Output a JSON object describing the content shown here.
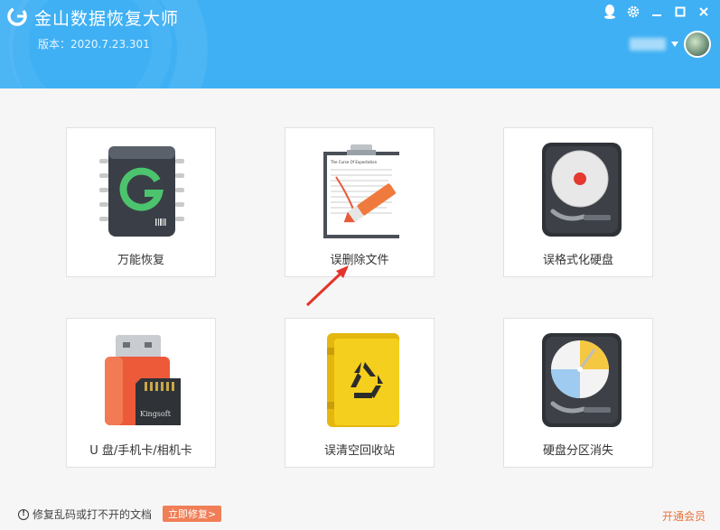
{
  "header": {
    "title": "金山数据恢复大师",
    "version": "版本：2020.7.23.301",
    "window_controls": [
      {
        "name": "qq-icon"
      },
      {
        "name": "gear-icon"
      },
      {
        "name": "minimize-icon"
      },
      {
        "name": "maximize-icon"
      },
      {
        "name": "close-icon"
      }
    ],
    "brand_color": "#3fb0f4"
  },
  "cards": [
    {
      "label": "万能恢复",
      "icon": "chip-g-icon"
    },
    {
      "label": "误删除文件",
      "icon": "clipboard-pen-icon"
    },
    {
      "label": "误格式化硬盘",
      "icon": "hard-drive-icon"
    },
    {
      "label": "U 盘/手机卡/相机卡",
      "icon": "usb-sdcard-icon"
    },
    {
      "label": "误清空回收站",
      "icon": "recycle-bin-icon"
    },
    {
      "label": "硬盘分区消失",
      "icon": "partition-drive-icon"
    }
  ],
  "clipboard_doc_title": "The Curse Of Expectation",
  "sdcard_brand": "Kingsoft",
  "footer": {
    "note": "修复乱码或打不开的文档",
    "repair_button": "立即修复>",
    "vip_link": "开通会员",
    "accent_color": "#f07e56"
  }
}
